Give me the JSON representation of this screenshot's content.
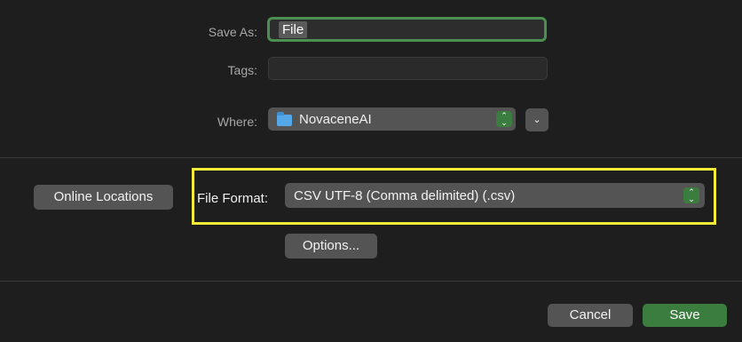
{
  "save_as": {
    "label": "Save As:",
    "value": "File"
  },
  "tags": {
    "label": "Tags:",
    "value": ""
  },
  "where": {
    "label": "Where:",
    "value": "NovaceneAI",
    "expand_glyph": "⌄",
    "stepper_up": "⌃",
    "stepper_down": "⌄"
  },
  "online_locations": {
    "label": "Online Locations"
  },
  "file_format": {
    "label": "File Format:",
    "value": "CSV UTF-8 (Comma delimited) (.csv)",
    "stepper_up": "⌃",
    "stepper_down": "⌄",
    "highlight_color": "#f5ec3a"
  },
  "options": {
    "label": "Options..."
  },
  "footer": {
    "cancel_label": "Cancel",
    "save_label": "Save",
    "accent_color": "#3a7d3e"
  },
  "icons": {
    "folder": "folder-icon",
    "stepper": "up-down-chevron-icon",
    "expand": "chevron-down-icon"
  }
}
